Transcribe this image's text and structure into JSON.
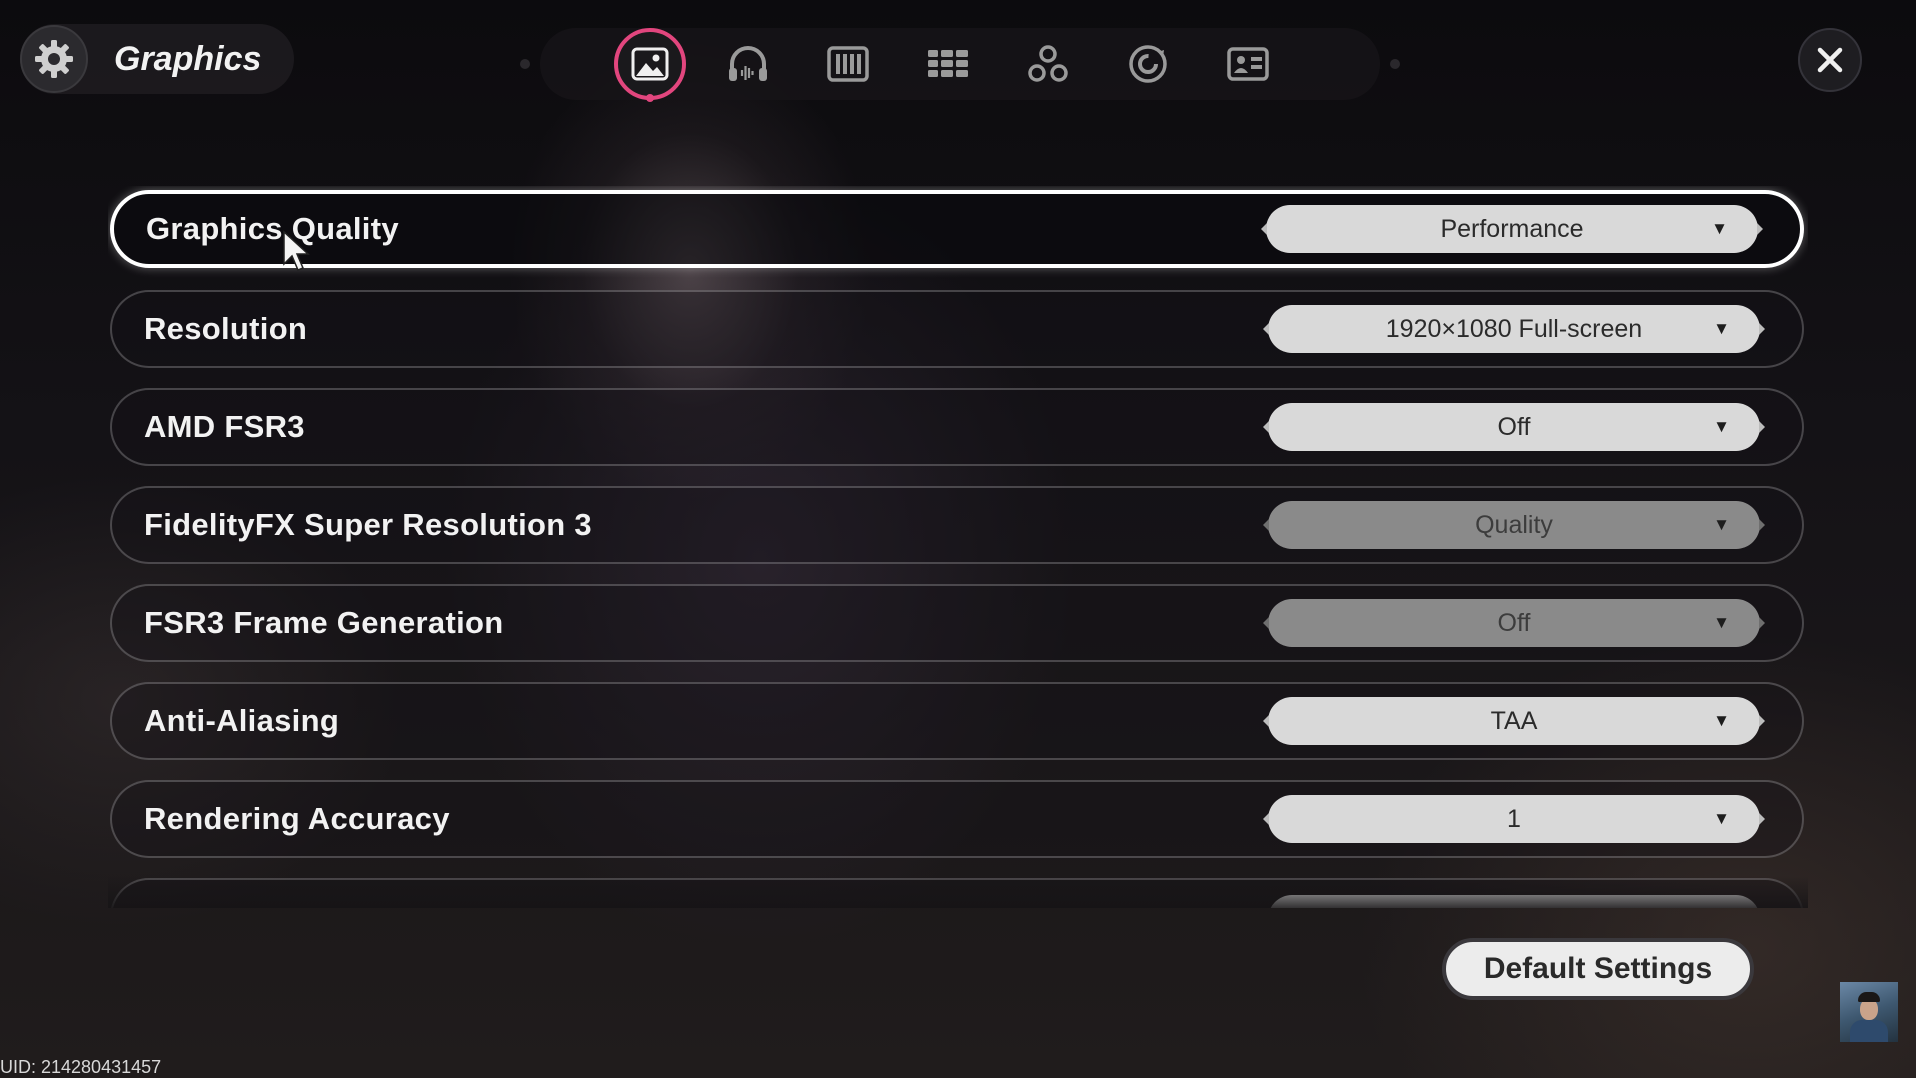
{
  "header": {
    "title": "Graphics",
    "settings_icon": "gear-icon",
    "close_icon": "close-icon"
  },
  "tabs": [
    {
      "icon": "image-icon",
      "active": true
    },
    {
      "icon": "headphones-icon",
      "active": false
    },
    {
      "icon": "keyboard-icon",
      "active": false
    },
    {
      "icon": "grid-icon",
      "active": false
    },
    {
      "icon": "controller-icon",
      "active": false
    },
    {
      "icon": "refresh-icon",
      "active": false
    },
    {
      "icon": "id-card-icon",
      "active": false
    }
  ],
  "settings": [
    {
      "label": "Graphics Quality",
      "value": "Performance",
      "selected": true,
      "disabled": false
    },
    {
      "label": "Resolution",
      "value": "1920×1080 Full-screen",
      "selected": false,
      "disabled": false
    },
    {
      "label": "AMD FSR3",
      "value": "Off",
      "selected": false,
      "disabled": false
    },
    {
      "label": "FidelityFX Super Resolution 3",
      "value": "Quality",
      "selected": false,
      "disabled": true
    },
    {
      "label": "FSR3 Frame Generation",
      "value": "Off",
      "selected": false,
      "disabled": true
    },
    {
      "label": "Anti-Aliasing",
      "value": "TAA",
      "selected": false,
      "disabled": false
    },
    {
      "label": "Rendering Accuracy",
      "value": "1",
      "selected": false,
      "disabled": false
    }
  ],
  "footer": {
    "default_button": "Default Settings",
    "uid": "UID: 214280431457"
  },
  "colors": {
    "accent": "#e2467e",
    "dropdown": "#d9d9d9",
    "dropdown_disabled": "#8a8a8a"
  }
}
